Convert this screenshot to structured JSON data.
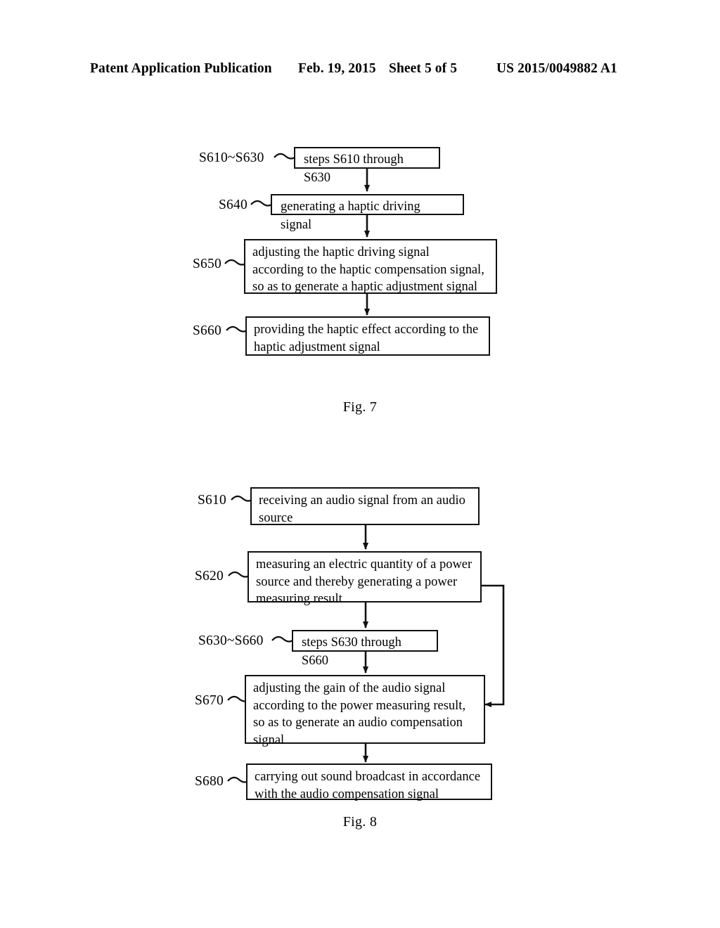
{
  "header": {
    "publication": "Patent Application Publication",
    "date": "Feb. 19, 2015",
    "sheet": "Sheet 5 of 5",
    "number": "US 2015/0049882 A1"
  },
  "figures": [
    {
      "caption": "Fig. 7",
      "steps": [
        {
          "ref": "S610~S630",
          "text": "steps S610 through S630"
        },
        {
          "ref": "S640",
          "text": "generating a haptic driving signal"
        },
        {
          "ref": "S650",
          "text": "adjusting the haptic driving signal\naccording to the haptic compensation signal,\nso as to generate a haptic adjustment signal"
        },
        {
          "ref": "S660",
          "text": "providing the haptic effect according to the\nhaptic adjustment signal"
        }
      ]
    },
    {
      "caption": "Fig. 8",
      "steps": [
        {
          "ref": "S610",
          "text": "receiving an audio signal from an audio\nsource"
        },
        {
          "ref": "S620",
          "text": "measuring an electric quantity of a power\nsource and thereby generating a power\nmeasuring result"
        },
        {
          "ref": "S630~S660",
          "text": "steps S630 through S660"
        },
        {
          "ref": "S670",
          "text": "adjusting the gain of the audio signal\naccording to the power measuring result,\nso as to generate an audio compensation\nsignal"
        },
        {
          "ref": "S680",
          "text": "carrying out sound broadcast in accordance\nwith the audio compensation signal"
        }
      ]
    }
  ],
  "colors": {
    "ink": "#111111",
    "paper": "#ffffff"
  }
}
